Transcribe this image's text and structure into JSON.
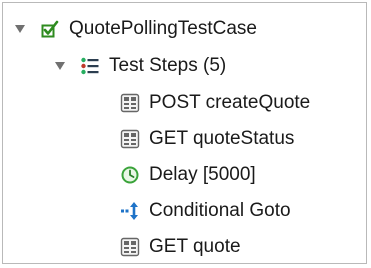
{
  "tree": {
    "root": {
      "label": "QuotePollingTestCase",
      "icon": "testcase-check-icon",
      "expanded": true
    },
    "group": {
      "label": "Test Steps (5)",
      "icon": "test-steps-list-icon",
      "expanded": true
    },
    "steps": [
      {
        "label": "POST createQuote",
        "icon": "rest-request-icon"
      },
      {
        "label": "GET quoteStatus",
        "icon": "rest-request-icon"
      },
      {
        "label": "Delay [5000]",
        "icon": "clock-icon"
      },
      {
        "label": "Conditional Goto",
        "icon": "conditional-goto-icon"
      },
      {
        "label": "GET quote",
        "icon": "rest-request-icon"
      }
    ]
  },
  "colors": {
    "testcase_green": "#2e8b1f",
    "list_red": "#c0392b",
    "list_green": "#27ae60",
    "list_dark": "#2c3e50",
    "clock_green": "#3aa33a",
    "goto_blue": "#1e73c8",
    "rest_gray": "#666666",
    "border": "#b9b9b9"
  }
}
